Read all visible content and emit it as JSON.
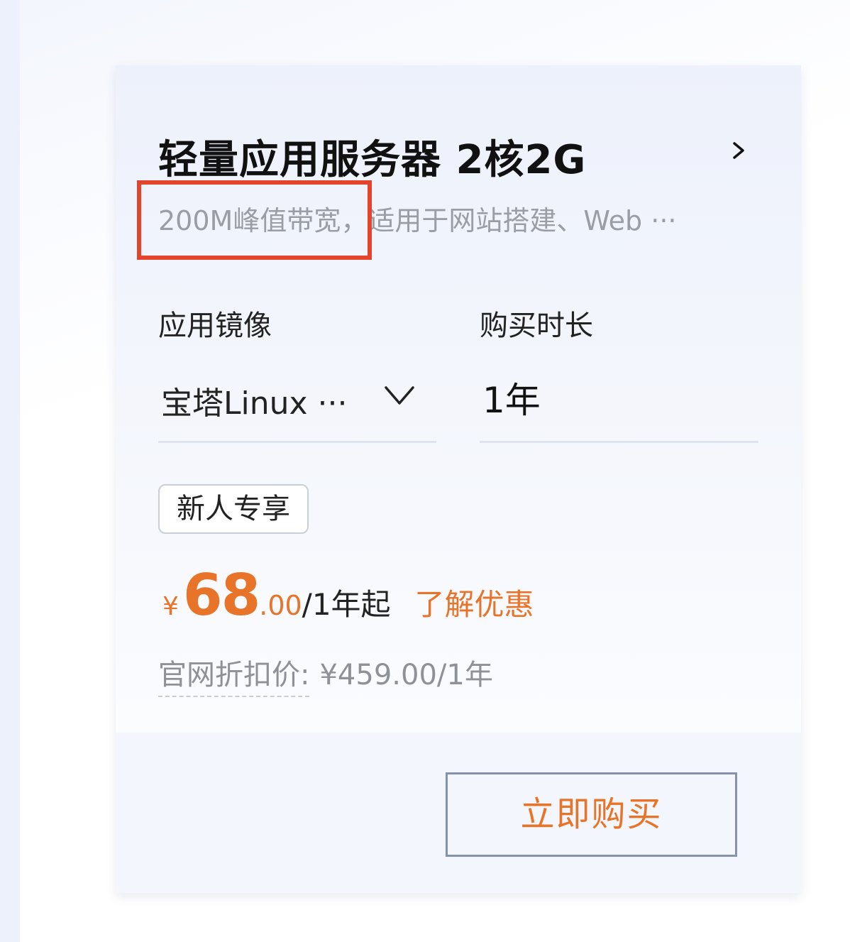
{
  "product": {
    "title": "轻量应用服务器 2核2G",
    "description": "200M峰值带宽，适用于网站搭建、Web ···"
  },
  "image_selector": {
    "label": "应用镜像",
    "value": "宝塔Linux ···"
  },
  "duration": {
    "label": "购买时长",
    "value": "1年"
  },
  "badge": {
    "label": "新人专享"
  },
  "price": {
    "currency": "¥",
    "integer": "68",
    "decimal": ".00",
    "unit": "/1年起",
    "promo_link": "了解优惠"
  },
  "original_price": {
    "label": "官网折扣价:",
    "value": "¥459.00/1年"
  },
  "buy_button": {
    "label": "立即购买"
  },
  "colors": {
    "accent": "#e8742a",
    "highlight_box": "#e2452c",
    "button_border": "#8592a8"
  },
  "icons": {
    "detail": "chevron-right-icon",
    "dropdown": "chevron-down-icon"
  }
}
